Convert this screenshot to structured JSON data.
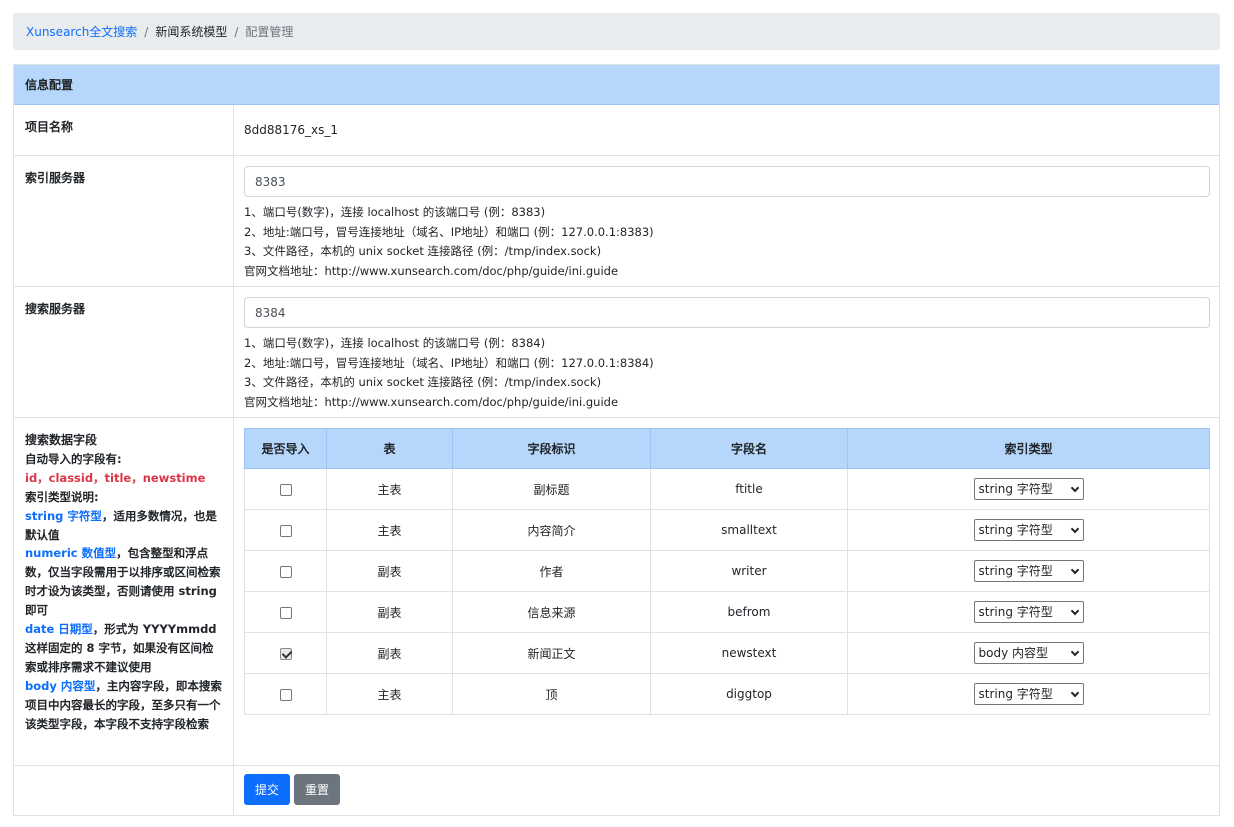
{
  "breadcrumb": {
    "home": "Xunsearch全文搜索",
    "model": "新闻系统模型",
    "current": "配置管理"
  },
  "panel": {
    "title": "信息配置"
  },
  "project": {
    "label": "项目名称",
    "value": "8dd88176_xs_1"
  },
  "index_server": {
    "label": "索引服务器",
    "value": "8383",
    "help": [
      "1、端口号(数字)，连接 localhost 的该端口号 (例：8383)",
      "2、地址:端口号，冒号连接地址（域名、IP地址）和端口 (例：127.0.0.1:8383)",
      "3、文件路径，本机的 unix socket 连接路径 (例：/tmp/index.sock)",
      "官网文档地址：http://www.xunsearch.com/doc/php/guide/ini.guide"
    ]
  },
  "search_server": {
    "label": "搜索服务器",
    "value": "8384",
    "help": [
      "1、端口号(数字)，连接 localhost 的该端口号 (例：8384)",
      "2、地址:端口号，冒号连接地址（域名、IP地址）和端口 (例：127.0.0.1:8384)",
      "3、文件路径，本机的 unix socket 连接路径 (例：/tmp/index.sock)",
      "官网文档地址：http://www.xunsearch.com/doc/php/guide/ini.guide"
    ]
  },
  "fields_side": {
    "title": "搜索数据字段",
    "auto_label": "自动导入的字段有:",
    "auto_fields": "id，classid，title，newstime",
    "type_label": "索引类型说明:",
    "string_term": "string 字符型",
    "string_desc": "，适用多数情况，也是默认值",
    "numeric_term": "numeric 数值型",
    "numeric_desc": "，包含整型和浮点数，仅当字段需用于以排序或区间检索时才设为该类型，否则请使用 string 即可",
    "date_term": "date 日期型",
    "date_desc": "，形式为 YYYYmmdd 这样固定的 8 字节，如果没有区间检索或排序需求不建议使用",
    "body_term": "body 内容型",
    "body_desc": "，主内容字段，即本搜索项目中内容最长的字段，至多只有一个该类型字段，本字段不支持字段检索"
  },
  "fields_table": {
    "headers": [
      "是否导入",
      "表",
      "字段标识",
      "字段名",
      "索引类型"
    ],
    "rows": [
      {
        "checked": false,
        "table": "主表",
        "label": "副标题",
        "name": "ftitle",
        "type": "string 字符型"
      },
      {
        "checked": false,
        "table": "主表",
        "label": "内容简介",
        "name": "smalltext",
        "type": "string 字符型"
      },
      {
        "checked": false,
        "table": "副表",
        "label": "作者",
        "name": "writer",
        "type": "string 字符型"
      },
      {
        "checked": false,
        "table": "副表",
        "label": "信息来源",
        "name": "befrom",
        "type": "string 字符型"
      },
      {
        "checked": true,
        "table": "副表",
        "label": "新闻正文",
        "name": "newstext",
        "type": "body 内容型"
      },
      {
        "checked": false,
        "table": "主表",
        "label": "顶",
        "name": "diggtop",
        "type": "string 字符型"
      }
    ]
  },
  "actions": {
    "submit": "提交",
    "reset": "重置"
  }
}
